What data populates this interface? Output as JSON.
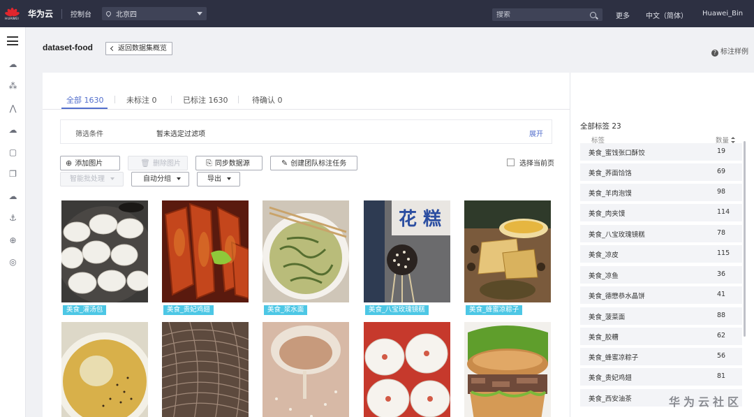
{
  "topbar": {
    "logo_word": "HUAWEI",
    "brand": "华为云",
    "console": "控制台",
    "region": "北京四",
    "search_placeholder": "搜索",
    "more": "更多",
    "language": "中文（简体）",
    "user": "Huawei_Bin"
  },
  "header": {
    "title": "dataset-food",
    "back": "返回数据集概览",
    "help": "标注样例"
  },
  "tabs": [
    {
      "label": "全部 1630",
      "active": true
    },
    {
      "label": "未标注 0"
    },
    {
      "label": "已标注 1630"
    },
    {
      "label": "待确认 0"
    }
  ],
  "filter": {
    "label": "筛选条件",
    "value": "暂未选定过滤项",
    "expand": "展开"
  },
  "toolbar": {
    "add_image": "添加图片",
    "delete_image": "删除图片",
    "sync_source": "同步数据源",
    "create_team_task": "创建团队标注任务",
    "batch_process": "智能批处理",
    "auto_group": "自动分组",
    "export": "导出",
    "select_page": "选择当前页"
  },
  "images": [
    {
      "tag": "美食_灌汤包"
    },
    {
      "tag": "美食_贵妃鸡翅"
    },
    {
      "tag": "美食_浆水面"
    },
    {
      "tag": "美食_八宝玫瑰镜糕"
    },
    {
      "tag": "美食_蜂蜜凉粽子"
    },
    {
      "tag": ""
    },
    {
      "tag": ""
    },
    {
      "tag": ""
    },
    {
      "tag": ""
    },
    {
      "tag": ""
    }
  ],
  "labels": {
    "header": "全部标签",
    "count": "23",
    "col_name": "标签",
    "col_count": "数量",
    "items": [
      {
        "name": "美食_蜜饯张口酥饺",
        "count": "19"
      },
      {
        "name": "美食_荞面饸饹",
        "count": "69"
      },
      {
        "name": "美食_羊肉泡馍",
        "count": "98"
      },
      {
        "name": "美食_肉夹馍",
        "count": "114"
      },
      {
        "name": "美食_八宝玫瑰镜糕",
        "count": "78"
      },
      {
        "name": "美食_凉皮",
        "count": "115"
      },
      {
        "name": "美食_凉鱼",
        "count": "36"
      },
      {
        "name": "美食_德懋恭水晶饼",
        "count": "41"
      },
      {
        "name": "美食_菠菜面",
        "count": "88"
      },
      {
        "name": "美食_胶糟",
        "count": "62"
      },
      {
        "name": "美食_蜂蜜凉粽子",
        "count": "56"
      },
      {
        "name": "美食_贵妃鸡翅",
        "count": "81"
      },
      {
        "name": "美食_西安油茶",
        "count": ""
      }
    ]
  },
  "watermark": "华为云社区"
}
